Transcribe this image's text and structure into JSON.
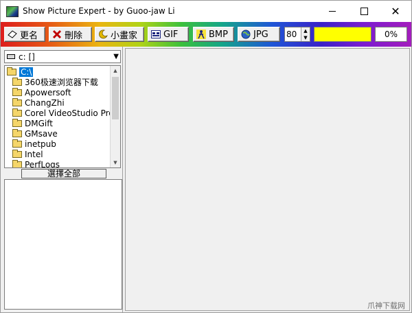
{
  "window": {
    "title": "Show Picture Expert - by Guoo-jaw Li",
    "controls": {
      "minimize": "—",
      "maximize": "☐",
      "close": "✕"
    }
  },
  "toolbar": {
    "buttons": [
      {
        "label": "更名",
        "icon": "rename-icon"
      },
      {
        "label": "刪除",
        "icon": "delete-icon"
      },
      {
        "label": "小畫家",
        "icon": "paint-icon"
      },
      {
        "label": "GIF",
        "icon": "gif-icon"
      },
      {
        "label": "BMP",
        "icon": "bmp-icon"
      },
      {
        "label": "JPG",
        "icon": "jpg-icon"
      }
    ],
    "quality_value": "80",
    "progress_text": "0%",
    "color_swatch": "#ffff00"
  },
  "left_panel": {
    "drive_selected": "c: []",
    "directories": [
      {
        "name": "C:\\",
        "selected": true
      },
      {
        "name": "360极速浏览器下载"
      },
      {
        "name": "Apowersoft"
      },
      {
        "name": "ChangZhi"
      },
      {
        "name": "Corel VideoStudio Pro"
      },
      {
        "name": "DMGift"
      },
      {
        "name": "GMsave"
      },
      {
        "name": "inetpub"
      },
      {
        "name": "Intel"
      },
      {
        "name": "PerfLogs"
      }
    ],
    "select_all_label": "選擇全部"
  },
  "watermark": "爪神下载网"
}
